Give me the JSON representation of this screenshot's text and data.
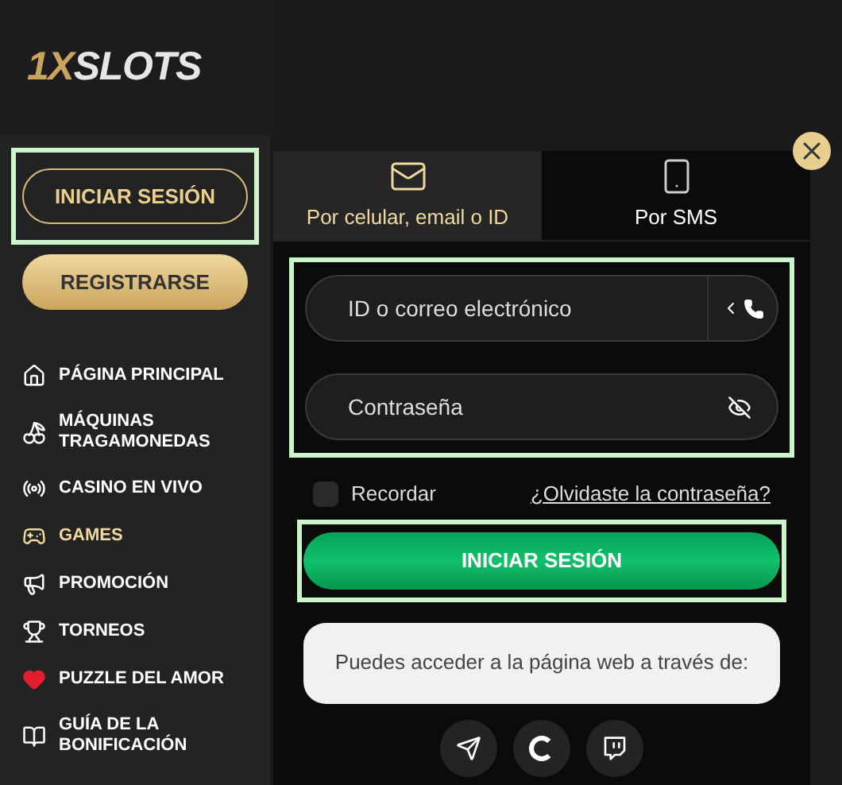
{
  "logo": {
    "accent": "1X",
    "text": "SLOTS"
  },
  "sidebar": {
    "login_button": "INICIAR SESIÓN",
    "register_button": "REGISTRARSE",
    "items": [
      {
        "kind": "home",
        "label": "PÁGINA PRINCIPAL",
        "selected": false
      },
      {
        "kind": "cherry",
        "label": "MÁQUINAS TRAGAMONEDAS",
        "selected": false
      },
      {
        "kind": "live",
        "label": "CASINO EN VIVO",
        "selected": false
      },
      {
        "kind": "gamepad",
        "label": "GAMES",
        "selected": true
      },
      {
        "kind": "megaphone",
        "label": "PROMOCIÓN",
        "selected": false
      },
      {
        "kind": "trophy",
        "label": "TORNEOS",
        "selected": false
      },
      {
        "kind": "heart",
        "label": "PUZZLE DEL AMOR",
        "selected": false
      },
      {
        "kind": "book",
        "label": "GUÍA DE LA BONIFICACIÓN",
        "selected": false
      }
    ]
  },
  "login_dialog": {
    "tabs": [
      {
        "kind": "mail",
        "label": "Por celular, email o ID",
        "selected": true
      },
      {
        "kind": "phone",
        "label": "Por SMS",
        "selected": false
      }
    ],
    "id_field": {
      "placeholder": "ID o correo electrónico"
    },
    "password_field": {
      "placeholder": "Contraseña"
    },
    "remember": {
      "label": "Recordar",
      "checked": false
    },
    "forgot_link": "¿Olvidaste la contraseña?",
    "submit_button": "INICIAR SESIÓN",
    "social_prompt": "Puedes acceder a la página web a través de:",
    "social_buttons": [
      {
        "kind": "telegram"
      },
      {
        "kind": "google"
      },
      {
        "kind": "twitch"
      }
    ]
  }
}
